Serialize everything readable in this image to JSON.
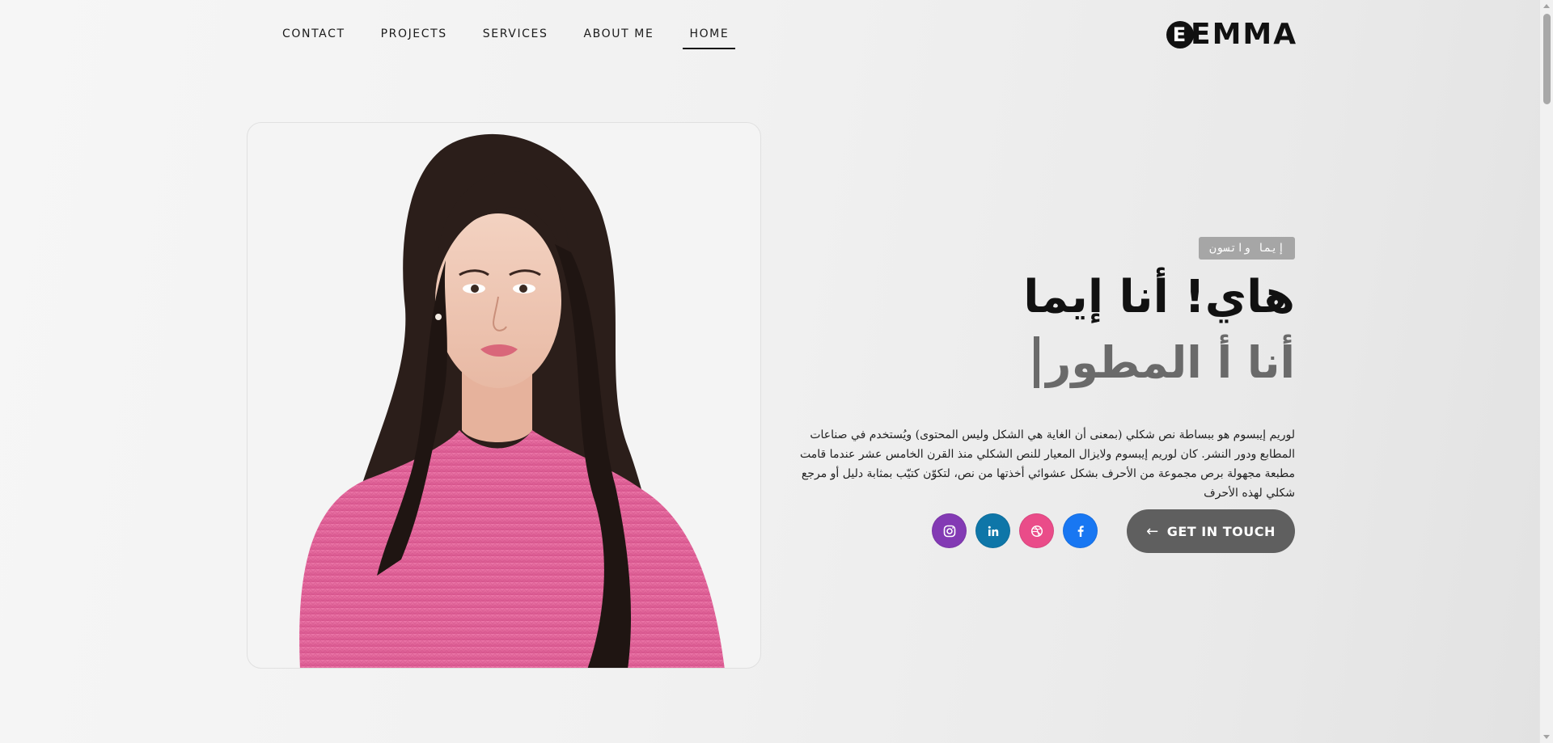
{
  "nav": {
    "items": [
      "CONTACT",
      "PROJECTS",
      "SERVICES",
      "ABOUT ME",
      "HOME"
    ],
    "active": "HOME"
  },
  "logo": {
    "mark": "E",
    "text": "EMMA"
  },
  "hero": {
    "tag": "إيما واتسون",
    "title": "هاي! أنا إيما",
    "role": "أنا أ المطور",
    "description": "لوريم إيبسوم هو ببساطة نص شكلي (بمعنى أن الغاية هي الشكل وليس المحتوى) ويُستخدم في صناعات المطابع ودور النشر. كان لوريم إيبسوم ولايزال المعيار للنص الشكلي منذ القرن الخامس عشر عندما قامت مطبعة مجهولة برص مجموعة من الأحرف بشكل عشوائي أخذتها من نص، لتكوّن كتيّب بمثابة دليل أو مرجع شكلي لهذه الأحرف",
    "cta_label": "GET IN TOUCH"
  },
  "socials": [
    {
      "name": "instagram-icon",
      "color": "#833ab4"
    },
    {
      "name": "linkedin-icon",
      "color": "#0e76a8"
    },
    {
      "name": "dribbble-icon",
      "color": "#ea4c89"
    },
    {
      "name": "facebook-icon",
      "color": "#1877f2"
    }
  ],
  "colors": {
    "accent_dark": "#111111",
    "cta_bg": "#5f5f5f",
    "tag_bg": "#a6a6a6",
    "role_text": "#6a6a6a",
    "sweater_pink": "#e86aa0"
  }
}
